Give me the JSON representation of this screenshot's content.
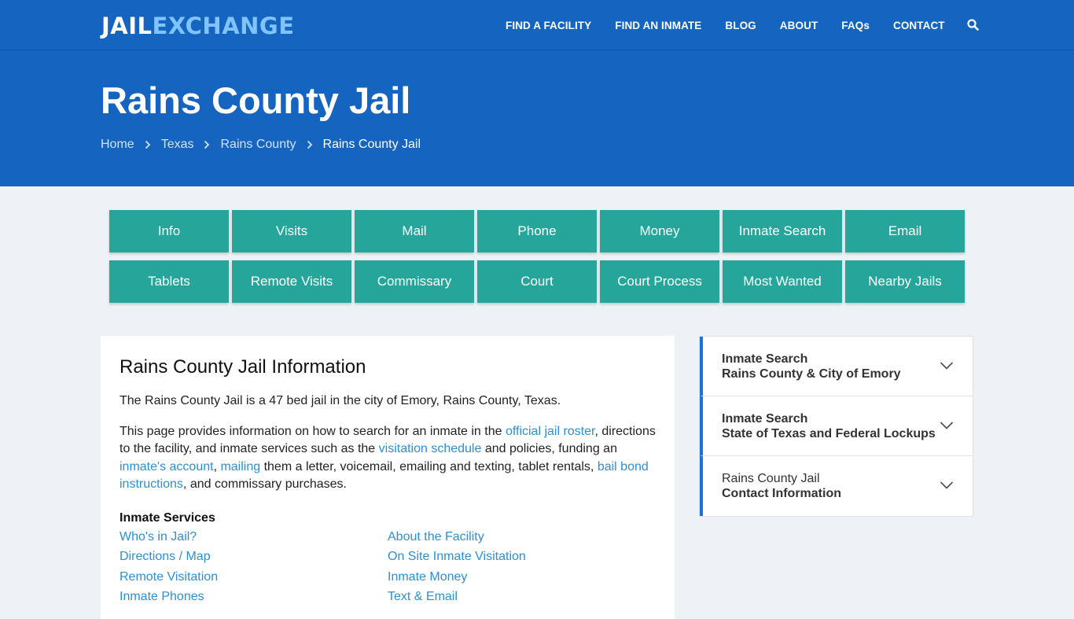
{
  "header": {
    "logo_part1": "JAIL",
    "logo_part2": "EXCHANGE",
    "nav": [
      "FIND A FACILITY",
      "FIND AN INMATE",
      "BLOG",
      "ABOUT",
      "FAQs",
      "CONTACT"
    ],
    "search_icon": "search-icon"
  },
  "hero": {
    "title": "Rains County Jail",
    "breadcrumbs": [
      "Home",
      "Texas",
      "Rains County"
    ],
    "current": "Rains County Jail"
  },
  "tabs": [
    "Info",
    "Visits",
    "Mail",
    "Phone",
    "Money",
    "Inmate Search",
    "Email",
    "Tablets",
    "Remote Visits",
    "Commissary",
    "Court",
    "Court Process",
    "Most Wanted",
    "Nearby Jails"
  ],
  "main": {
    "heading": "Rains County Jail Information",
    "intro": "The Rains County Jail is a 47 bed jail in the city of Emory, Rains County, Texas.",
    "para": {
      "t1": "This page provides information on how to search for an inmate in the ",
      "link1": "official jail roster",
      "t2": ", directions to the facility, and inmate services such as the ",
      "link2": "visitation schedule",
      "t3": " and policies, funding an ",
      "link3": "inmate's account",
      "t4": ", ",
      "link4": "mailing",
      "t5": " them a letter, voicemail, emailing and texting, tablet rentals, ",
      "link5": "bail bond instructions",
      "t6": ", and commissary purchases."
    },
    "services_title": "Inmate Services",
    "services": [
      "Who's in Jail?",
      "About the Facility",
      "Directions / Map",
      "On Site Inmate Visitation",
      "Remote Visitation",
      "Inmate Money",
      "Inmate Phones",
      "Text & Email"
    ]
  },
  "sidebar": [
    {
      "line1": "Inmate Search",
      "line2": "Rains County & City of Emory"
    },
    {
      "line1": "Inmate Search",
      "line2": "State of Texas and Federal Lockups"
    },
    {
      "line1": "Rains County Jail",
      "line2": "Contact Information"
    }
  ],
  "colors": {
    "primary": "#1565c0",
    "teal": "#26a69a",
    "link": "#2d8fd5"
  }
}
